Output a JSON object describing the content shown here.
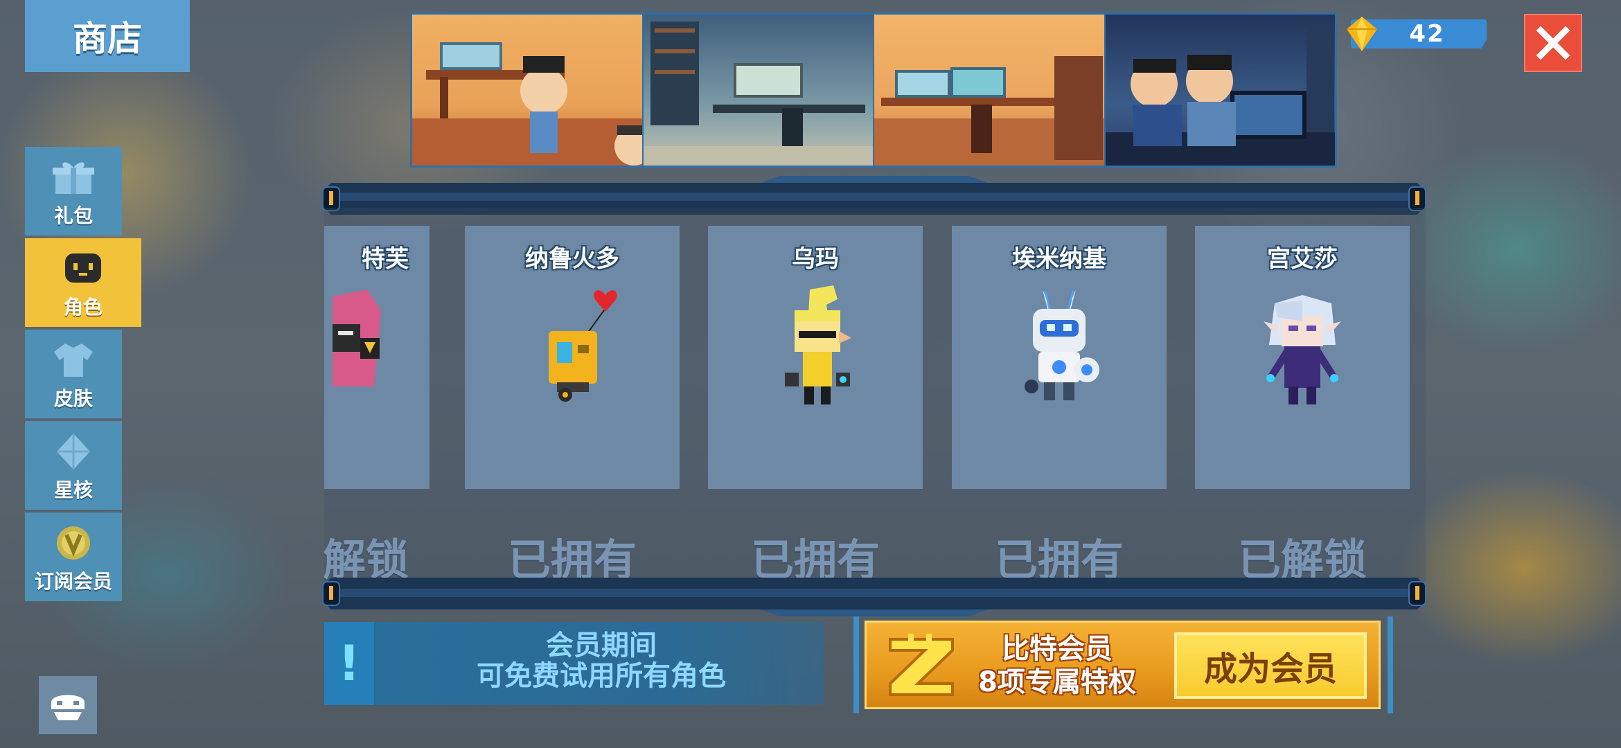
{
  "header": {
    "title": "商店"
  },
  "sidebar": {
    "items": [
      {
        "label": "礼包",
        "icon": "gift-icon",
        "active": false
      },
      {
        "label": "角色",
        "icon": "character-face-icon",
        "active": true
      },
      {
        "label": "皮肤",
        "icon": "shirt-icon",
        "active": false
      },
      {
        "label": "星核",
        "icon": "star-core-icon",
        "active": false
      },
      {
        "label": "订阅会员",
        "icon": "vip-badge-icon",
        "active": false
      }
    ]
  },
  "currency": {
    "icon": "gem-icon",
    "amount": "42"
  },
  "cards": [
    {
      "name": "特芙",
      "status": "解锁",
      "partial": true
    },
    {
      "name": "纳鲁火多",
      "status": "已拥有"
    },
    {
      "name": "乌玛",
      "status": "已拥有"
    },
    {
      "name": "埃米纳基",
      "status": "已拥有"
    },
    {
      "name": "宫艾莎",
      "status": "已解锁"
    }
  ],
  "info": {
    "icon": "exclamation-icon",
    "line1": "会员期间",
    "line2": "可免费试用所有角色"
  },
  "vip": {
    "line1": "比特会员",
    "line2": "8项专属特权",
    "button": "成为会员"
  },
  "colors": {
    "sidebar": "#4e90b6",
    "sidebar_active": "#f2c23a",
    "card": "#6e89a6",
    "close": "#ea4e3b",
    "vip": "#f4b235"
  }
}
